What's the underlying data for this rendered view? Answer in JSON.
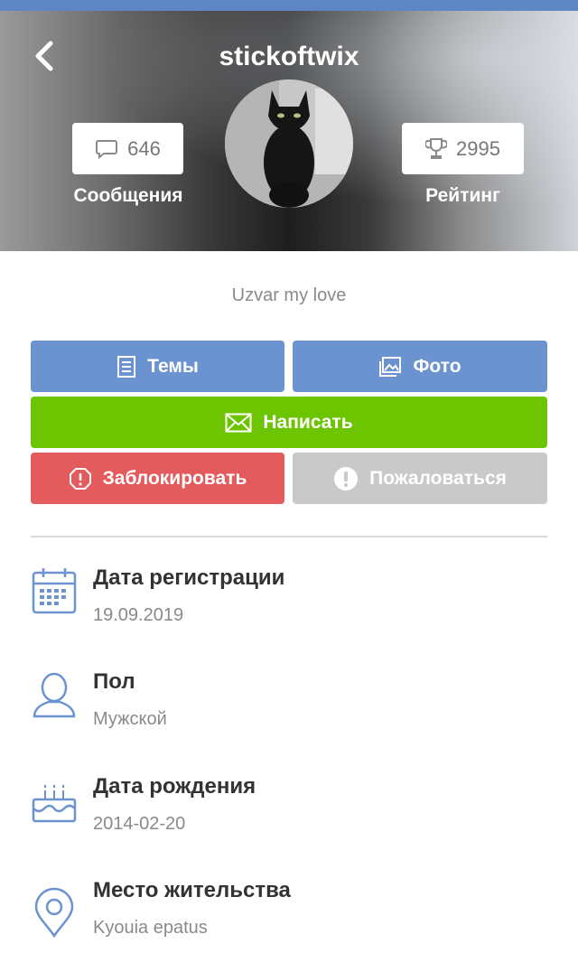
{
  "colors": {
    "statusbar": "#5e86c4",
    "blue_button": "#6a93d0",
    "green_button": "#6dc502",
    "red_button": "#e45b5d",
    "gray_button": "#c9c9c9",
    "icon_blue": "#6a93d0"
  },
  "header": {
    "username": "stickoftwix",
    "back_icon": "chevron-left-icon"
  },
  "stats": {
    "messages": {
      "count": "646",
      "label": "Сообщения",
      "icon": "comment-icon"
    },
    "rating": {
      "count": "2995",
      "label": "Рейтинг",
      "icon": "trophy-icon"
    }
  },
  "avatar": {
    "icon": "black-cat-photo"
  },
  "status_text": "Uzvar my love",
  "buttons": {
    "themes": {
      "label": "Темы",
      "icon": "document-icon"
    },
    "photo": {
      "label": "Фото",
      "icon": "image-icon"
    },
    "write": {
      "label": "Написать",
      "icon": "envelope-icon"
    },
    "block": {
      "label": "Заблокировать",
      "icon": "block-icon"
    },
    "report": {
      "label": "Пожаловаться",
      "icon": "exclamation-icon"
    }
  },
  "info": [
    {
      "title": "Дата регистрации",
      "value": "19.09.2019",
      "icon": "calendar-icon"
    },
    {
      "title": "Пол",
      "value": "Мужской",
      "icon": "user-icon"
    },
    {
      "title": "Дата рождения",
      "value": "2014-02-20",
      "icon": "birthday-cake-icon"
    },
    {
      "title": "Место жительства",
      "value": "Kyouia epatus",
      "icon": "location-pin-icon"
    }
  ]
}
